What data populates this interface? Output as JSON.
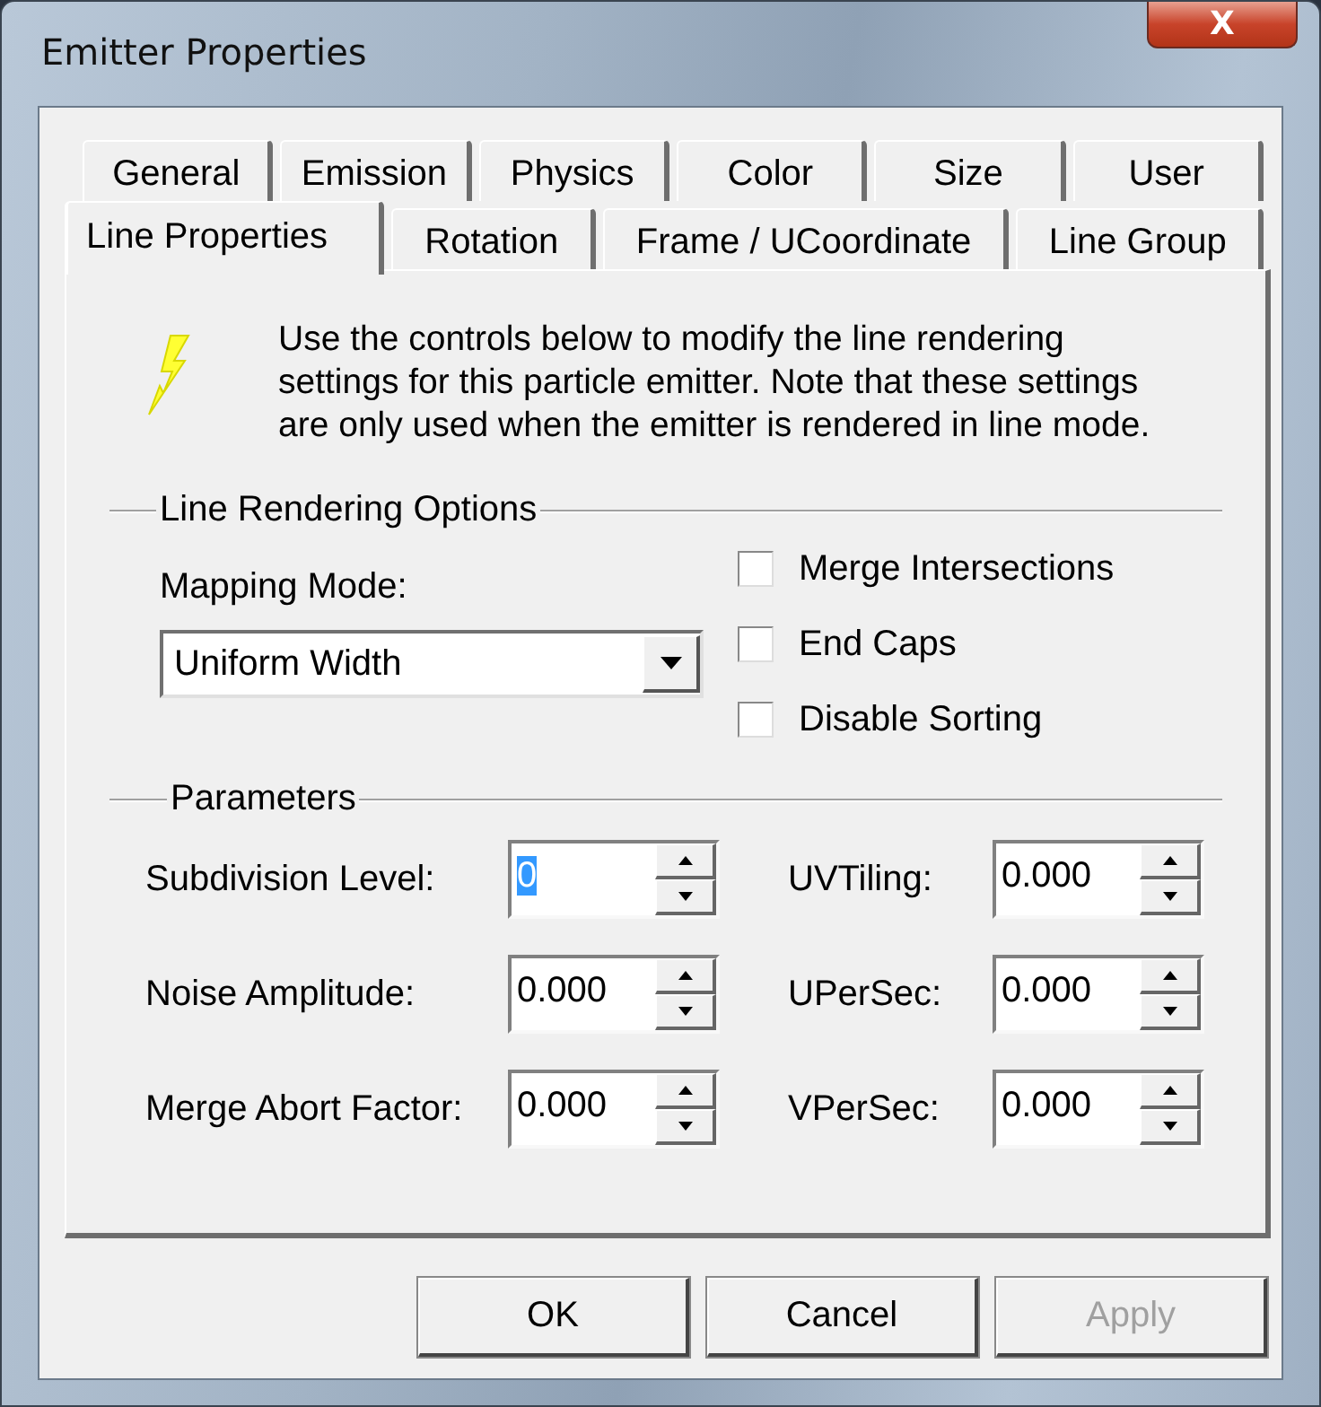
{
  "window": {
    "title": "Emitter Properties",
    "close_label": "X"
  },
  "tab_rows": [
    [
      {
        "label": "General",
        "selected": false
      },
      {
        "label": "Emission",
        "selected": false
      },
      {
        "label": "Physics",
        "selected": false
      },
      {
        "label": "Color",
        "selected": false
      },
      {
        "label": "Size",
        "selected": false
      },
      {
        "label": "User",
        "selected": false
      }
    ],
    [
      {
        "label": "Line Properties",
        "selected": true
      },
      {
        "label": "Rotation",
        "selected": false
      },
      {
        "label": "Frame / UCoordinate",
        "selected": false
      },
      {
        "label": "Line Group",
        "selected": false
      }
    ]
  ],
  "description": "Use the controls below to modify the line rendering settings for this particle emitter.  Note that these settings are only used when the emitter is rendered in line mode.",
  "line_rendering": {
    "title": "Line Rendering Options",
    "mapping_label": "Mapping Mode:",
    "mapping_value": "Uniform Width",
    "checkboxes": [
      {
        "label": "Merge Intersections",
        "checked": false
      },
      {
        "label": "End Caps",
        "checked": false
      },
      {
        "label": "Disable Sorting",
        "checked": false
      }
    ]
  },
  "parameters": {
    "title": "Parameters",
    "left": [
      {
        "label": "Subdivision Level:",
        "value": "0",
        "highlighted": true
      },
      {
        "label": "Noise Amplitude:",
        "value": "0.000",
        "highlighted": false
      },
      {
        "label": "Merge Abort Factor:",
        "value": "0.000",
        "highlighted": false
      }
    ],
    "right": [
      {
        "label": "UVTiling:",
        "value": "0.000",
        "highlighted": false
      },
      {
        "label": "UPerSec:",
        "value": "0.000",
        "highlighted": false
      },
      {
        "label": "VPerSec:",
        "value": "0.000",
        "highlighted": false
      }
    ]
  },
  "buttons": [
    {
      "label": "OK",
      "disabled": false
    },
    {
      "label": "Cancel",
      "disabled": false
    },
    {
      "label": "Apply",
      "disabled": true
    }
  ]
}
